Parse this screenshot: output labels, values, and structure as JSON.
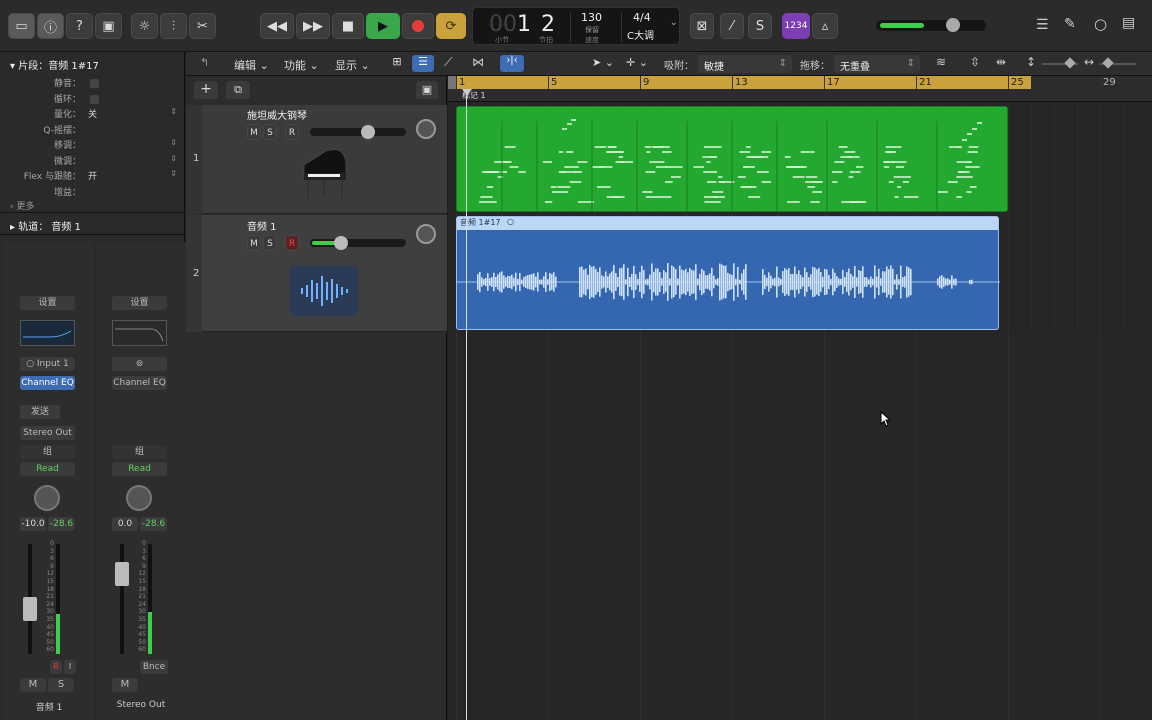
{
  "transport": {
    "bar": "1",
    "beat": "2",
    "bar_label": "小节",
    "beat_label": "节拍",
    "tempo": "130",
    "tempo_sub": "保留",
    "tempo_label": "速度",
    "signature": "4/4",
    "key": "C大调",
    "count_in": "1234",
    "rec_color": "#e53b3b",
    "play_color": "#3aa84a",
    "cycle_color": "#c9a23c"
  },
  "inspector": {
    "region_header": "片段：音频 1#17",
    "rows": [
      {
        "label": "静音：",
        "value": "",
        "checkbox": true
      },
      {
        "label": "循环：",
        "value": "",
        "checkbox": true
      },
      {
        "label": "量化：",
        "value": "关",
        "stepper": true
      },
      {
        "label": "Q-摇摆：",
        "value": ""
      },
      {
        "label": "移调：",
        "value": "",
        "stepper": true
      },
      {
        "label": "微调：",
        "value": "",
        "stepper": true
      },
      {
        "label": "Flex 与跟随：",
        "value": "开",
        "stepper": true
      },
      {
        "label": "增益：",
        "value": ""
      }
    ],
    "more": "更多",
    "track_header": "轨道：  音频 1"
  },
  "strips": [
    {
      "setting": "设置",
      "input": "Input 1",
      "eq": "Channel EQ",
      "send": "发送",
      "output": "Stereo Out",
      "group": "组",
      "automation": "Read",
      "volume": "-10.0",
      "peak": "-28.6",
      "rec": "R",
      "input_mon": "I",
      "mute": "M",
      "solo": "S",
      "name": "音频 1",
      "scale": [
        "0",
        "3",
        "6",
        "9",
        "12",
        "15",
        "18",
        "21",
        "24",
        "30",
        "35",
        "40",
        "45",
        "50",
        "60"
      ]
    },
    {
      "setting": "设置",
      "eq": "Channel EQ",
      "group": "组",
      "automation": "Read",
      "volume": "0.0",
      "peak": "-28.6",
      "bounce": "Bnce",
      "mute": "M",
      "name": "Stereo Out",
      "scale": [
        "0",
        "3",
        "6",
        "9",
        "12",
        "15",
        "18",
        "21",
        "24",
        "30",
        "35",
        "40",
        "45",
        "50",
        "60"
      ]
    }
  ],
  "toolbar": {
    "edit": "编辑",
    "functions": "功能",
    "view": "显示",
    "snap_label": "吸附：",
    "snap_value": "敏捷",
    "drag_label": "拖移：",
    "drag_value": "无重叠"
  },
  "tracks": [
    {
      "number": "1",
      "name": "施坦威大钢琴",
      "mute": "M",
      "solo": "S",
      "rec": "R",
      "type": "software-instrument",
      "volume": 0.6
    },
    {
      "number": "2",
      "name": "音频 1",
      "mute": "M",
      "solo": "S",
      "rec": "R",
      "type": "audio",
      "volume": 0.32
    }
  ],
  "ruler": {
    "bars": [
      "1",
      "5",
      "9",
      "13",
      "17",
      "21",
      "25",
      "29"
    ],
    "marker": "标记 1",
    "cycle_start_bar": 1,
    "cycle_end_bar": 26
  },
  "regions": {
    "midi_color": "#23a830",
    "audio_color": "#3567b0",
    "audio_name": "音频 1#17"
  }
}
